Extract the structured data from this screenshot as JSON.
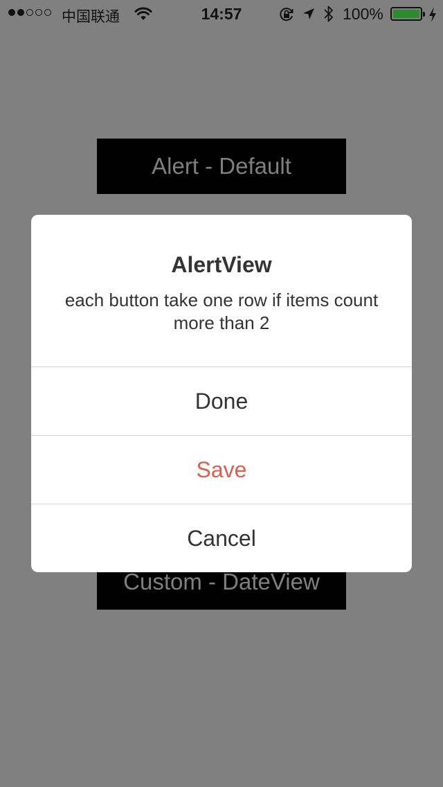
{
  "status_bar": {
    "signal_dots_filled": 2,
    "signal_dots_total": 5,
    "carrier": "中国联通",
    "time": "14:57",
    "battery_percent": "100%",
    "battery_level": 1.0,
    "battery_color": "#2e8a2e",
    "icons": [
      "wifi-icon",
      "orientation-lock-icon",
      "location-arrow-icon",
      "bluetooth-icon",
      "battery-icon",
      "charging-bolt-icon"
    ]
  },
  "background_buttons": {
    "top_label": "Alert - Default",
    "bottom_label": "Custom - DateView"
  },
  "alert": {
    "title": "AlertView",
    "message": "each button take one row if items count more than 2",
    "buttons": [
      {
        "label": "Done",
        "style": "default"
      },
      {
        "label": "Save",
        "style": "destructive",
        "color": "#d9604f"
      },
      {
        "label": "Cancel",
        "style": "default"
      }
    ]
  }
}
